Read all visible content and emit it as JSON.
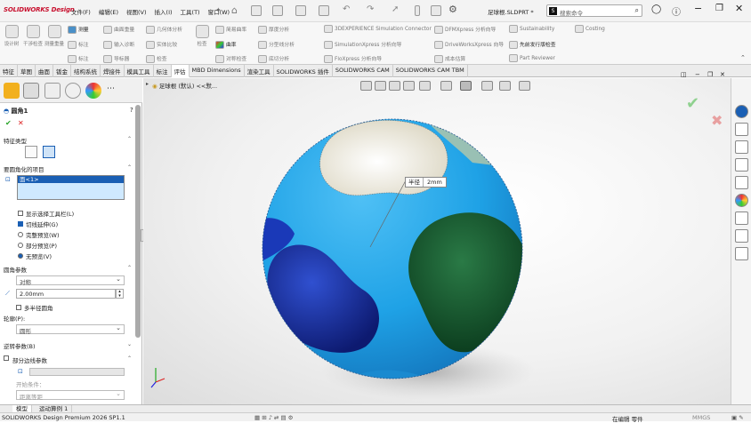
{
  "app": {
    "logo_text": "SOLIDWORKS Design",
    "document_name": "足球根.SLDPRT *",
    "search_placeholder": "搜索命令"
  },
  "menu": [
    "文件(F)",
    "编辑(E)",
    "视图(V)",
    "插入(I)",
    "工具(T)",
    "窗口(W)"
  ],
  "ribbon": {
    "big_buttons": [
      "设计树",
      "干涉检查",
      "测量重量",
      "测量"
    ],
    "col1": [
      "测量",
      "标注",
      "标注"
    ],
    "items": [
      {
        "label": "曲面重量",
        "col": 1
      },
      {
        "label": "输入诊断",
        "col": 1
      },
      {
        "label": "导标器",
        "col": 1
      },
      {
        "label": "几何体分析",
        "col": 2
      },
      {
        "label": "实体比较",
        "col": 2
      },
      {
        "label": "检查",
        "col": 2
      },
      {
        "label": "简易曲率",
        "col": 3
      },
      {
        "label": "曲率",
        "col": 3
      },
      {
        "label": "对称检查",
        "col": 3
      },
      {
        "label": "厚度分析",
        "col": 4
      },
      {
        "label": "分型线分析",
        "col": 4
      },
      {
        "label": "底切分析",
        "col": 4
      },
      {
        "label": "3DEXPERIENCE Simulation Connector",
        "col": 5
      },
      {
        "label": "SimulationXpress 分析向导",
        "col": 5
      },
      {
        "label": "FloXpress 分析向导",
        "col": 5
      },
      {
        "label": "DFMXpress 分析向导",
        "col": 6
      },
      {
        "label": "DriveWorksXpress 向导",
        "col": 6
      },
      {
        "label": "成本估算",
        "col": 6
      },
      {
        "label": "Sustainability",
        "col": 7
      },
      {
        "label": "先前发行版检查",
        "col": 7
      },
      {
        "label": "Part Reviewer",
        "col": 7
      },
      {
        "label": "Costing",
        "col": 8
      }
    ]
  },
  "tabs": [
    "特征",
    "草图",
    "曲面",
    "钣金",
    "结构系统",
    "焊接件",
    "模具工具",
    "标注",
    "评估",
    "MBD Dimensions",
    "渲染工具",
    "SOLIDWORKS 插件",
    "SOLIDWORKS CAM",
    "SOLIDWORKS CAM TBM"
  ],
  "active_tab": "评估",
  "tree_path": "足球根 (默认) <<默...",
  "property_manager": {
    "title": "圆角1",
    "feature_type_header": "特征类型",
    "items_header": "要圆角化的项目",
    "selection_item": "面<1>",
    "show_toolbar": "显示选择工具栏(L)",
    "tangent_prop": "切线延伸(G)",
    "full_preview": "完整预览(W)",
    "partial_preview": "部分预览(P)",
    "no_preview": "无预览(V)",
    "params_header": "圆角参数",
    "symmetry": "对称",
    "radius_value": "2.00mm",
    "multi_radius": "多半径圆角",
    "profile_label": "轮廓(P):",
    "profile_value": "圆形",
    "setback_header": "逆转参数(B)",
    "partial_edge_header": "部分边线参数",
    "start_condition": "开始条件：",
    "start_value": "距离等距"
  },
  "callout": {
    "label": "半径",
    "value": "2mm"
  },
  "bottom_tabs": [
    "模型",
    "运动算例 1"
  ],
  "status": {
    "product": "SOLIDWORKS Design Premium 2026 SP1.1",
    "mode": "在编辑 零件",
    "units": "MMGS"
  },
  "colors": {
    "ball_light_blue": "#1fa2e6",
    "ball_dark_blue": "#1d2f9c",
    "ball_green": "#14532c",
    "ball_cream": "#e8e4d2",
    "accent": "#1a5fb4",
    "logo_red": "#c8102e"
  }
}
